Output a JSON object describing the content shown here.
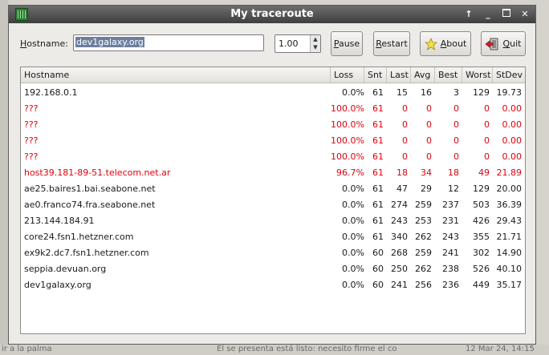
{
  "window": {
    "title": "My traceroute"
  },
  "background": {
    "left_text": "ir a la palma",
    "mid_text": "El se presenta está listo: necesito firme el co",
    "right_text": "12 Mar 24, 14:15"
  },
  "toolbar": {
    "hostname_label": "Hostname:",
    "hostname_value": "dev1galaxy.org",
    "interval_value": "1.00",
    "pause_label": "Pause",
    "restart_label": "Restart",
    "about_label": "About",
    "quit_label": "Quit"
  },
  "table": {
    "columns": [
      "Hostname",
      "Loss",
      "Snt",
      "Last",
      "Avg",
      "Best",
      "Worst",
      "StDev"
    ],
    "rows": [
      {
        "host": "192.168.0.1",
        "loss": "0.0%",
        "snt": "61",
        "last": "15",
        "avg": "16",
        "best": "3",
        "worst": "129",
        "stdev": "19.73",
        "red": false
      },
      {
        "host": "???",
        "loss": "100.0%",
        "snt": "61",
        "last": "0",
        "avg": "0",
        "best": "0",
        "worst": "0",
        "stdev": "0.00",
        "red": true
      },
      {
        "host": "???",
        "loss": "100.0%",
        "snt": "61",
        "last": "0",
        "avg": "0",
        "best": "0",
        "worst": "0",
        "stdev": "0.00",
        "red": true
      },
      {
        "host": "???",
        "loss": "100.0%",
        "snt": "61",
        "last": "0",
        "avg": "0",
        "best": "0",
        "worst": "0",
        "stdev": "0.00",
        "red": true
      },
      {
        "host": "???",
        "loss": "100.0%",
        "snt": "61",
        "last": "0",
        "avg": "0",
        "best": "0",
        "worst": "0",
        "stdev": "0.00",
        "red": true
      },
      {
        "host": "host39.181-89-51.telecom.net.ar",
        "loss": "96.7%",
        "snt": "61",
        "last": "18",
        "avg": "34",
        "best": "18",
        "worst": "49",
        "stdev": "21.89",
        "red": true
      },
      {
        "host": "ae25.baires1.bai.seabone.net",
        "loss": "0.0%",
        "snt": "61",
        "last": "47",
        "avg": "29",
        "best": "12",
        "worst": "129",
        "stdev": "20.00",
        "red": false
      },
      {
        "host": "ae0.franco74.fra.seabone.net",
        "loss": "0.0%",
        "snt": "61",
        "last": "274",
        "avg": "259",
        "best": "237",
        "worst": "503",
        "stdev": "36.39",
        "red": false
      },
      {
        "host": "213.144.184.91",
        "loss": "0.0%",
        "snt": "61",
        "last": "243",
        "avg": "253",
        "best": "231",
        "worst": "426",
        "stdev": "29.43",
        "red": false
      },
      {
        "host": "core24.fsn1.hetzner.com",
        "loss": "0.0%",
        "snt": "61",
        "last": "340",
        "avg": "262",
        "best": "243",
        "worst": "355",
        "stdev": "21.71",
        "red": false
      },
      {
        "host": "ex9k2.dc7.fsn1.hetzner.com",
        "loss": "0.0%",
        "snt": "60",
        "last": "268",
        "avg": "259",
        "best": "241",
        "worst": "302",
        "stdev": "14.90",
        "red": false
      },
      {
        "host": "seppia.devuan.org",
        "loss": "0.0%",
        "snt": "60",
        "last": "250",
        "avg": "262",
        "best": "238",
        "worst": "526",
        "stdev": "40.10",
        "red": false
      },
      {
        "host": "dev1galaxy.org",
        "loss": "0.0%",
        "snt": "60",
        "last": "241",
        "avg": "256",
        "best": "236",
        "worst": "449",
        "stdev": "35.17",
        "red": false
      }
    ]
  },
  "colors": {
    "error_text": "#e0000b",
    "titlebar": "#4a4a4a"
  },
  "icons": {
    "about": "star-icon",
    "quit": "exit-icon",
    "app": "terminal-icon"
  }
}
